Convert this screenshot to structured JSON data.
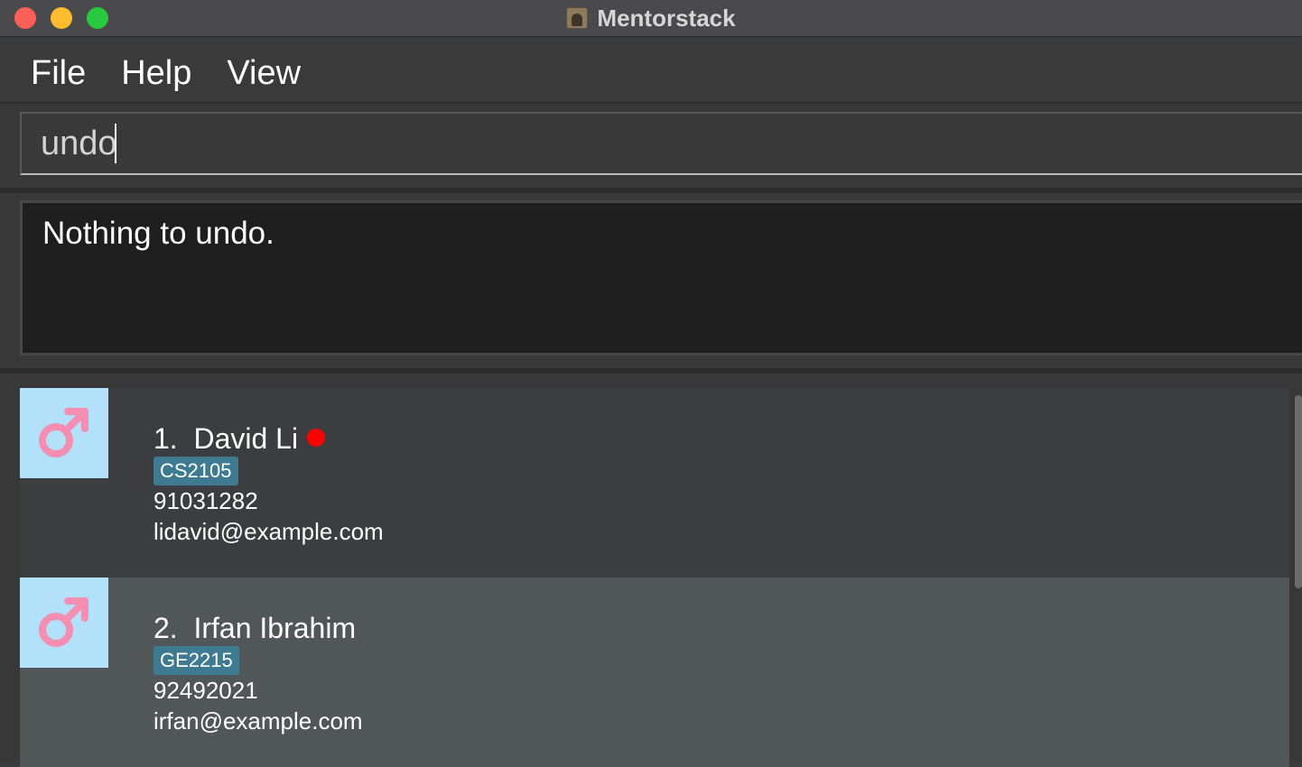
{
  "window": {
    "title": "Mentorstack"
  },
  "menu": {
    "items": [
      {
        "label": "File"
      },
      {
        "label": "Help"
      },
      {
        "label": "View"
      }
    ]
  },
  "command": {
    "value": "undo"
  },
  "result": {
    "message": "Nothing to undo."
  },
  "persons": [
    {
      "index": "1.",
      "name": "David Li",
      "tag": "CS2105",
      "phone": "91031282",
      "email": "lidavid@example.com",
      "gender_icon": "male-symbol-icon",
      "status_dot": true,
      "status_color": "#ff0000"
    },
    {
      "index": "2.",
      "name": "Irfan Ibrahim",
      "tag": "GE2215",
      "phone": "92492021",
      "email": "irfan@example.com",
      "gender_icon": "male-symbol-icon",
      "status_dot": false
    }
  ],
  "colors": {
    "avatar_bg": "#b4e1fa",
    "gender_symbol": "#f48fb1",
    "tag_bg": "#3e7b91",
    "selected_card_bg": "#515659",
    "card_bg": "#3c3d40"
  }
}
